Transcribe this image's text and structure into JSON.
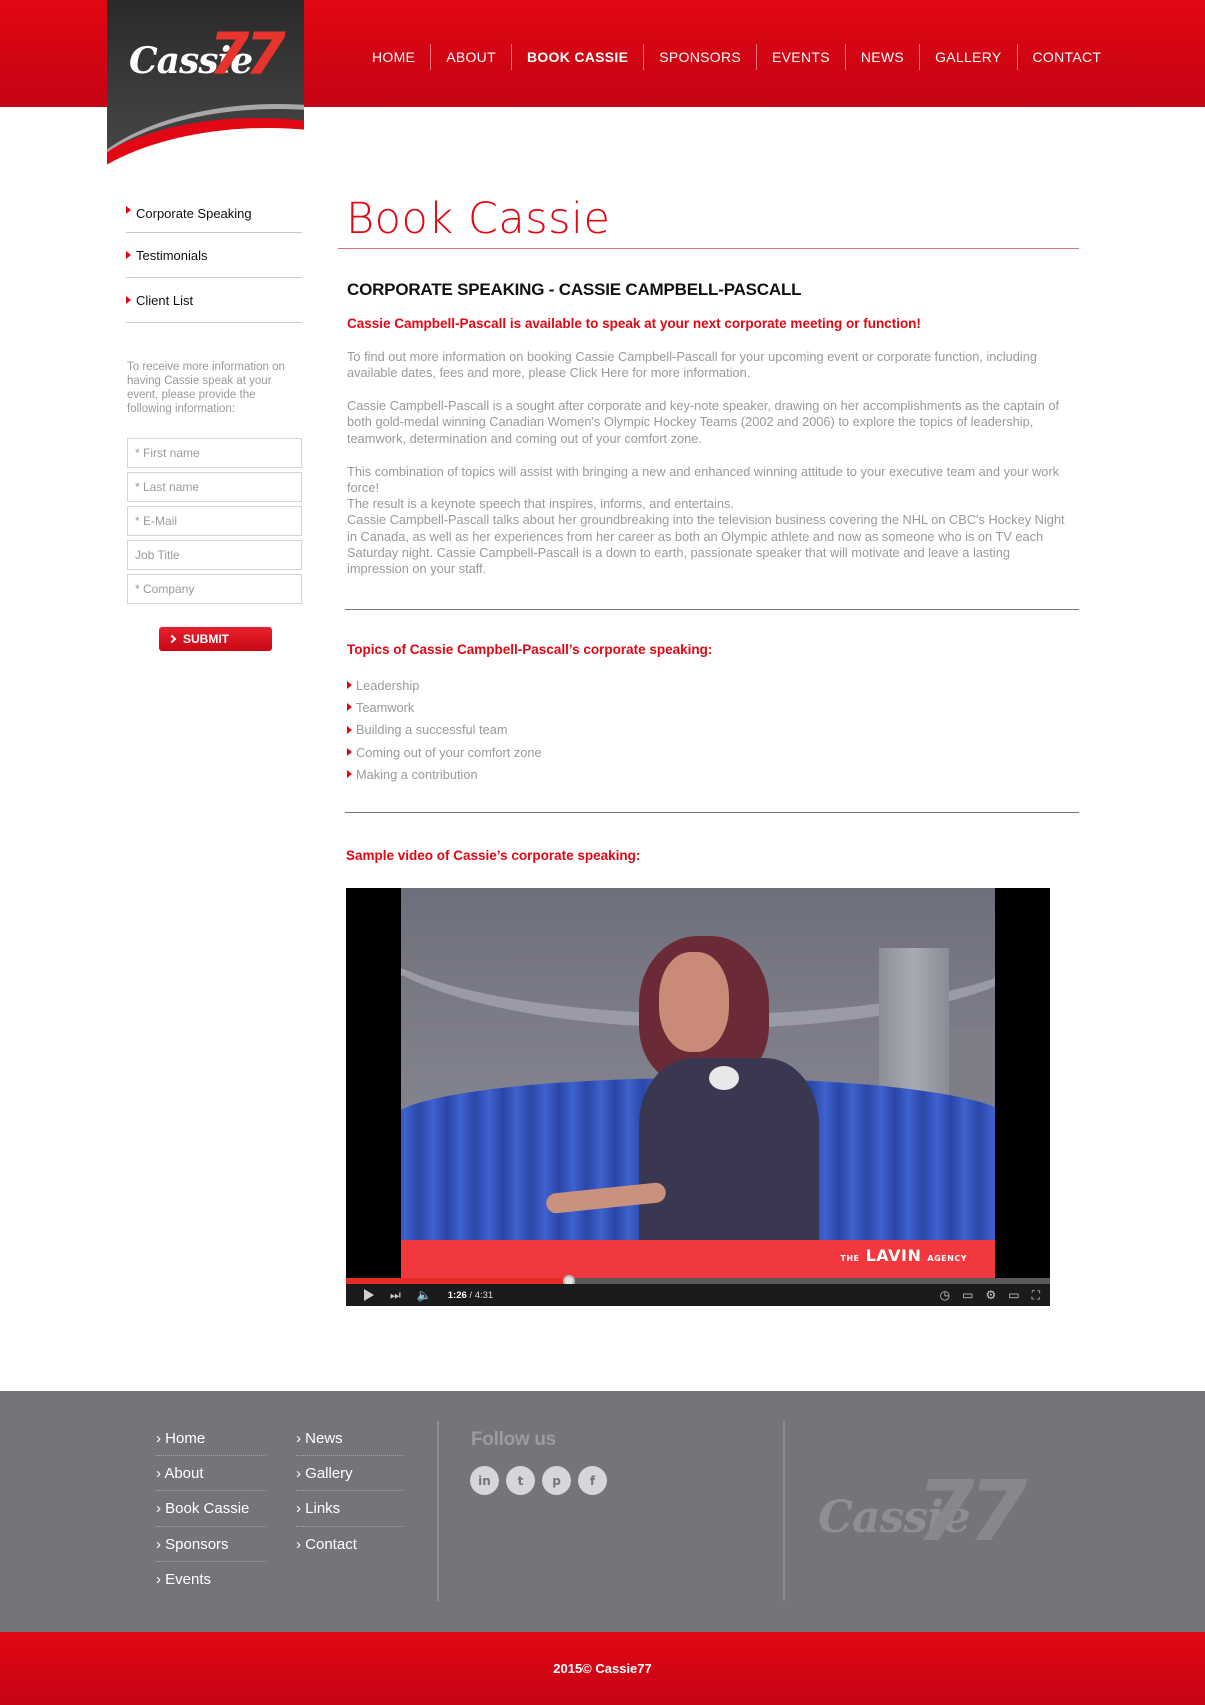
{
  "brand": {
    "word": "Cassie",
    "number": "77"
  },
  "nav": [
    "HOME",
    "ABOUT",
    "BOOK CASSIE",
    "SPONSORS",
    "EVENTS",
    "NEWS",
    "GALLERY",
    "CONTACT"
  ],
  "nav_active": "BOOK CASSIE",
  "sidebar": {
    "items": [
      "Corporate Speaking",
      "Testimonials",
      "Client List"
    ],
    "info": "To receive more information on having Cassie speak at your event, please provide the following information:",
    "form": {
      "first_name": "* First name",
      "last_name": "* Last name",
      "email": "* E-Mail",
      "job_title": "Job Title",
      "company": "* Company"
    },
    "submit": "SUBMIT"
  },
  "main": {
    "title": "Book Cassie",
    "heading": "CORPORATE SPEAKING - CASSIE CAMPBELL-PASCALL",
    "lead": "Cassie Campbell-Pascall is available to speak at your next corporate meeting or function!",
    "p1": "To find out more information on booking Cassie Campbell-Pascall for your upcoming event or corporate function, including available dates, fees and more, please Click Here for more information.",
    "p2": "Cassie Campbell-Pascall is a sought after corporate and key-note speaker, drawing on her accomplishments as the captain of both gold-medal winning Canadian Women's Olympic Hockey Teams (2002 and 2006) to explore the topics of leadership, teamwork, determination and coming out of your comfort zone.",
    "p3": "This combination of topics will assist with bringing a new and enhanced winning attitude to your executive team and your work force!",
    "p4a": "The result is a keynote speech that inspires, informs, and entertains.",
    "p4b": "Cassie Campbell-Pascall talks about her groundbreaking into the television business covering the NHL on CBC's Hockey Night in Canada, as well as her experiences from her career as both an Olympic athlete and now as someone who is on TV each Saturday night. Cassie Campbell-Pascall is a down to earth, passionate speaker that will motivate and leave a lasting impression on your staff.",
    "topics_heading": "Topics of Cassie Campbell-Pascall’s corporate speaking:",
    "topics": [
      "Leadership",
      "Teamwork",
      "Building a successful team",
      "Coming out of your comfort zone",
      "Making a contribution"
    ],
    "video_heading": "Sample video of Cassie’s corporate speaking:"
  },
  "video": {
    "current": "1:26",
    "duration": "4:31",
    "progress": 0.317,
    "overlay_brand": "LAVIN",
    "overlay_prefix": "THE",
    "overlay_suffix": "AGENCY"
  },
  "footer": {
    "col1": [
      "› Home",
      "› About",
      "› Book Cassie",
      "› Sponsors",
      "› Events"
    ],
    "col2": [
      "› News",
      "› Gallery",
      "› Links",
      "› Contact"
    ],
    "follow": "Follow us",
    "social": [
      "in",
      "t",
      "p",
      "f"
    ],
    "copyright": "2015© Cassie77"
  },
  "colors": {
    "brand_red": "#e30613",
    "footer_grey": "#757479"
  }
}
